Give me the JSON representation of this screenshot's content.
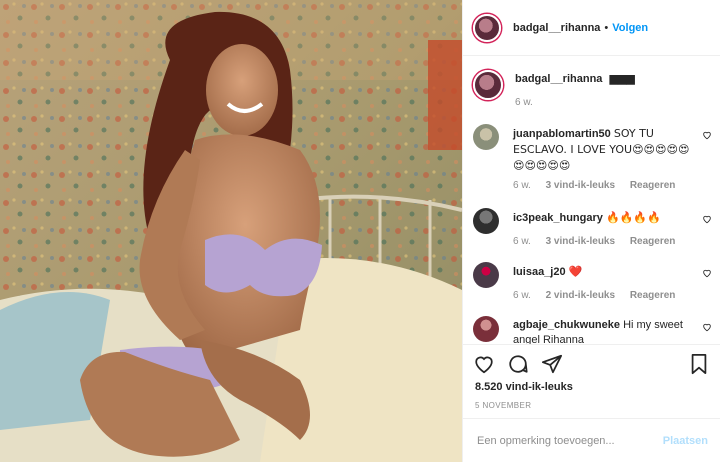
{
  "header": {
    "username": "badgal__rihanna",
    "separator": "•",
    "follow_label": "Volgen"
  },
  "caption": {
    "username": "badgal__rihanna",
    "text": "▆▆▆",
    "time": "6 w."
  },
  "comments": [
    {
      "username": "juanpablomartin50",
      "text": "SOY TU ESCLAVO. I LOVE YOU😍😍😍😍😍😍😍😍😍😍",
      "time": "6 w.",
      "likes": "3 vind-ik-leuks",
      "reply": "Reageren",
      "avatar_color": "#8a8f7a"
    },
    {
      "username": "ic3peak_hungary",
      "text": "🔥🔥🔥🔥",
      "time": "6 w.",
      "likes": "3 vind-ik-leuks",
      "reply": "Reageren",
      "avatar_color": "#2e2e2e"
    },
    {
      "username": "luisaa_j20",
      "text": "❤️",
      "time": "6 w.",
      "likes": "2 vind-ik-leuks",
      "reply": "Reageren",
      "avatar_color": "#4a3a48"
    },
    {
      "username": "agbaje_chukwuneke",
      "text": "Hi my sweet angel Rihanna",
      "time": "",
      "likes": "",
      "reply": "",
      "avatar_color": "#7a2f3a"
    }
  ],
  "likes_count": "8.520 vind-ik-leuks",
  "post_date": "5 NOVEMBER",
  "add_comment": {
    "placeholder": "Een opmerking toevoegen...",
    "post_label": "Plaatsen"
  },
  "colors": {
    "link": "#0095f6",
    "muted": "#8e8e8e",
    "post_disabled": "#b2dffc"
  }
}
